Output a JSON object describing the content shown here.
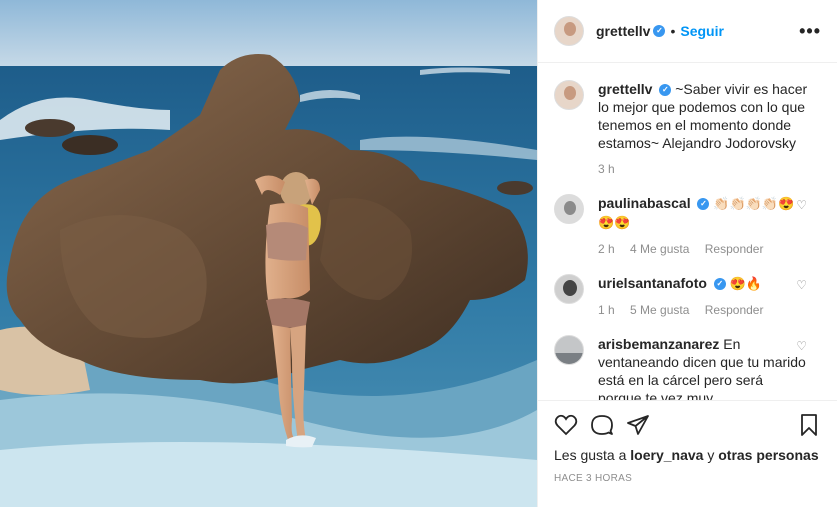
{
  "post": {
    "username": "grettellv",
    "follow_label": "Seguir",
    "more_label": "•••"
  },
  "caption": {
    "username": "grettellv",
    "text": "~Saber vivir es hacer lo mejor que podemos con lo que tenemos en el momento donde estamos~ Alejandro Jodorovsky",
    "time": "3 h"
  },
  "comments": [
    {
      "username": "paulinabascal",
      "text": "👏🏻👏🏻👏🏻👏🏻😍 😍😍",
      "time": "2 h",
      "likes": "4 Me gusta",
      "reply": "Responder"
    },
    {
      "username": "urielsantanafoto",
      "text": "😍🔥",
      "time": "1 h",
      "likes": "5 Me gusta",
      "reply": "Responder"
    },
    {
      "username": "arisbemanzanarez",
      "text": "En ventaneando dicen que tu marido está en la cárcel pero será porque te vez muy"
    }
  ],
  "likes": {
    "prefix": "Les gusta a",
    "user": "loery_nava",
    "middle": "y",
    "suffix": "otras personas"
  },
  "timestamp": "HACE 3 HORAS",
  "colors": {
    "accent": "#0095f6",
    "verified": "#3897f0",
    "muted": "#8e8e8e"
  }
}
